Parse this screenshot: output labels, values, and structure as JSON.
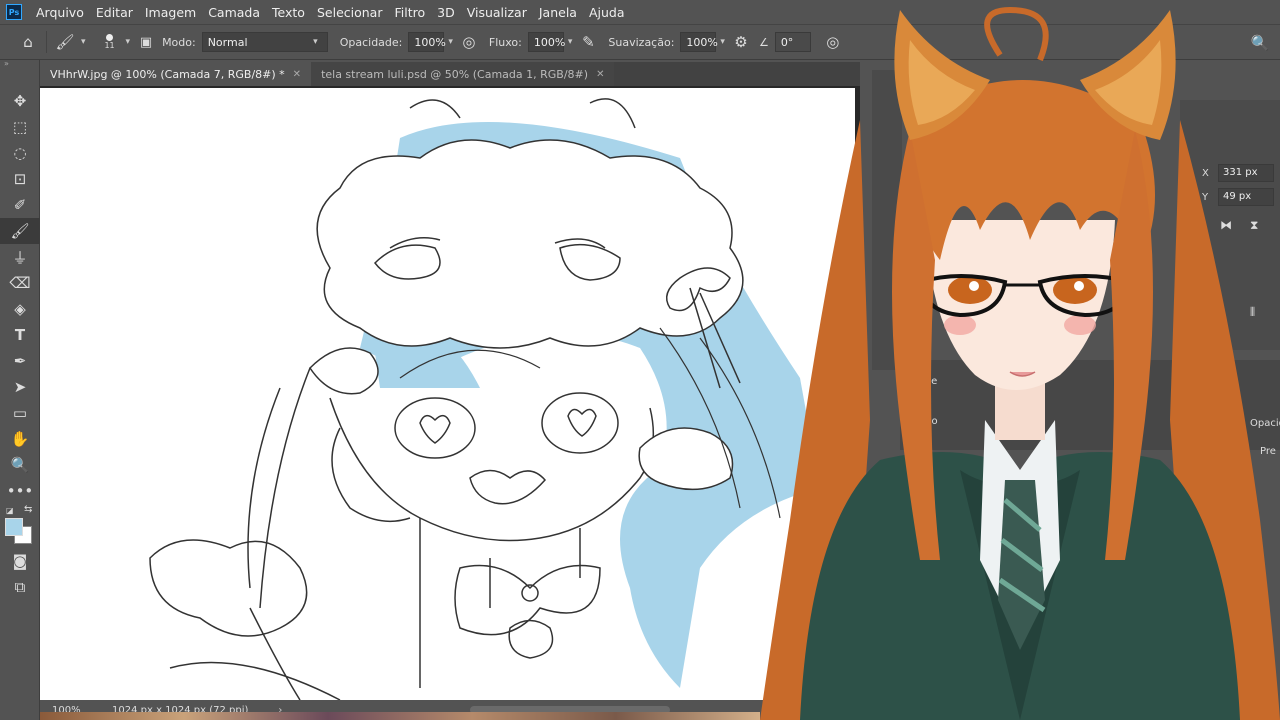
{
  "app": {
    "logo_text": "Ps",
    "menu": [
      "Arquivo",
      "Editar",
      "Imagem",
      "Camada",
      "Texto",
      "Selecionar",
      "Filtro",
      "3D",
      "Visualizar",
      "Janela",
      "Ajuda"
    ]
  },
  "options": {
    "brush_size": "11",
    "mode_label": "Modo:",
    "mode_value": "Normal",
    "opacity_label": "Opacidade:",
    "opacity_value": "100%",
    "flow_label": "Fluxo:",
    "flow_value": "100%",
    "smoothing_label": "Suavização:",
    "smoothing_value": "100%",
    "angle_value": "0°"
  },
  "tabs": [
    {
      "label": "VHhrW.jpg @ 100% (Camada 7, RGB/8#) *",
      "active": true
    },
    {
      "label": "tela stream luli.psd @ 50% (Camada 1, RGB/8#)",
      "active": false
    }
  ],
  "tools": [
    "move-tool",
    "marquee-tool",
    "lasso-tool",
    "object-select-tool",
    "healing-brush-tool",
    "brush-tool",
    "stamp-tool",
    "eraser-tool",
    "paint-bucket-tool",
    "type-tool",
    "pen-tool",
    "path-select-tool",
    "shape-tool",
    "hand-tool",
    "zoom-tool",
    "more-tools"
  ],
  "status": {
    "zoom": "100%",
    "doc_info": "1024 px x 1024 px (72 ppi)",
    "arrow": "›"
  },
  "properties": {
    "x_label": "X",
    "x_value": "331 px",
    "y_label": "Y",
    "y_value": "49 px"
  },
  "library": {
    "preset_label": "Prese",
    "library_label": "Biblio",
    "opacity_label": "Opacidad",
    "preset2_label": "Pre"
  },
  "colors": {
    "foreground": "#a8d4ea",
    "background": "#ffffff",
    "hair": "#c86a2a",
    "jacket": "#2d5148"
  }
}
